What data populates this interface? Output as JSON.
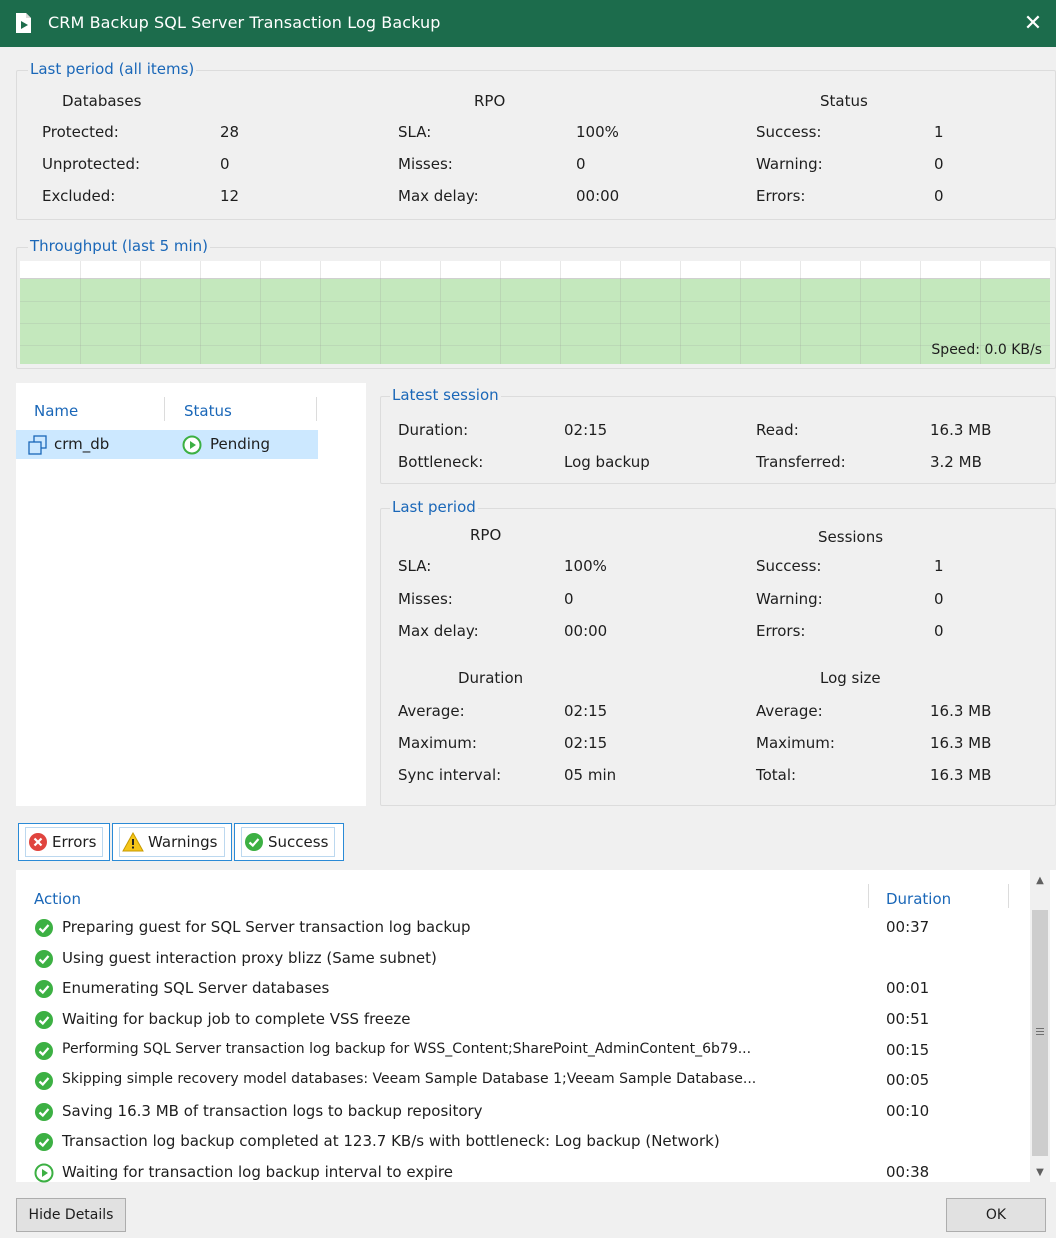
{
  "window": {
    "title": "CRM Backup SQL Server Transaction Log Backup",
    "close_glyph": "✕"
  },
  "last_period_all": {
    "legend": "Last period (all items)",
    "databases": {
      "header": "Databases",
      "rows": [
        {
          "label": "Protected:",
          "value": "28"
        },
        {
          "label": "Unprotected:",
          "value": "0"
        },
        {
          "label": "Excluded:",
          "value": "12"
        }
      ]
    },
    "rpo": {
      "header": "RPO",
      "rows": [
        {
          "label": "SLA:",
          "value": "100%"
        },
        {
          "label": "Misses:",
          "value": "0"
        },
        {
          "label": "Max delay:",
          "value": "00:00"
        }
      ]
    },
    "status": {
      "header": "Status",
      "rows": [
        {
          "label": "Success:",
          "value": "1"
        },
        {
          "label": "Warning:",
          "value": "0"
        },
        {
          "label": "Errors:",
          "value": "0"
        }
      ]
    }
  },
  "throughput": {
    "legend": "Throughput (last 5 min)",
    "speed": "Speed: 0.0 KB/s",
    "fill_color": "#c4e8bd"
  },
  "items_list": {
    "columns": {
      "name": "Name",
      "status": "Status"
    },
    "rows": [
      {
        "name": "crm_db",
        "status": "Pending",
        "icon": "database-icon",
        "status_icon": "play-icon"
      }
    ]
  },
  "latest_session": {
    "legend": "Latest session",
    "rows": [
      {
        "label": "Duration:",
        "value": "02:15",
        "label2": "Read:",
        "value2": "16.3 MB"
      },
      {
        "label": "Bottleneck:",
        "value": "Log backup",
        "label2": "Transferred:",
        "value2": "3.2 MB"
      }
    ]
  },
  "last_period": {
    "legend": "Last period",
    "rpo_header": "RPO",
    "sessions_header": "Sessions",
    "rpo_rows": [
      {
        "label": "SLA:",
        "value": "100%"
      },
      {
        "label": "Misses:",
        "value": "0"
      },
      {
        "label": "Max delay:",
        "value": "00:00"
      }
    ],
    "session_rows": [
      {
        "label": "Success:",
        "value": "1"
      },
      {
        "label": "Warning:",
        "value": "0"
      },
      {
        "label": "Errors:",
        "value": "0"
      }
    ],
    "duration_header": "Duration",
    "logsize_header": "Log size",
    "duration_rows": [
      {
        "label": "Average:",
        "value": "02:15"
      },
      {
        "label": "Maximum:",
        "value": "02:15"
      },
      {
        "label": "Sync interval:",
        "value": "05 min"
      }
    ],
    "logsize_rows": [
      {
        "label": "Average:",
        "value": "16.3 MB"
      },
      {
        "label": "Maximum:",
        "value": "16.3 MB"
      },
      {
        "label": "Total:",
        "value": "16.3 MB"
      }
    ]
  },
  "filters": {
    "errors": "Errors",
    "warnings": "Warnings",
    "success": "Success"
  },
  "actions": {
    "columns": {
      "action": "Action",
      "duration": "Duration"
    },
    "rows": [
      {
        "icon": "success-icon",
        "text": "Preparing guest for SQL Server transaction log backup",
        "duration": "00:37"
      },
      {
        "icon": "success-icon",
        "text": "Using guest interaction proxy blizz (Same subnet)",
        "duration": ""
      },
      {
        "icon": "success-icon",
        "text": "Enumerating SQL Server databases",
        "duration": "00:01"
      },
      {
        "icon": "success-icon",
        "text": "Waiting for backup job to complete VSS freeze",
        "duration": "00:51"
      },
      {
        "icon": "success-icon",
        "text": "Performing SQL Server transaction log backup for WSS_Content;SharePoint_AdminContent_6b79...",
        "duration": "00:15"
      },
      {
        "icon": "success-icon",
        "text": "Skipping simple recovery model databases: Veeam Sample Database 1;Veeam Sample Database...",
        "duration": "00:05"
      },
      {
        "icon": "success-icon",
        "text": "Saving 16.3 MB of transaction logs to backup repository",
        "duration": "00:10"
      },
      {
        "icon": "success-icon",
        "text": "Transaction log backup completed at 123.7 KB/s with bottleneck: Log backup (Network)",
        "duration": ""
      },
      {
        "icon": "pending-icon",
        "text": "Waiting for transaction log backup interval to expire",
        "duration": "00:38"
      }
    ]
  },
  "buttons": {
    "hide_details": "Hide Details",
    "ok": "OK"
  },
  "colors": {
    "title_bar": "#1c6c4c",
    "accent_blue": "#1a67b8",
    "success_green": "#3cb043",
    "error_red": "#e0443e",
    "warning_yellow": "#f5c518",
    "selection": "#cce8ff"
  }
}
